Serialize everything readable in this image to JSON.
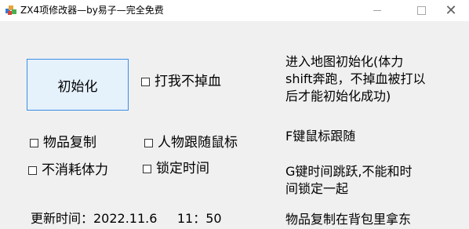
{
  "window": {
    "title": "ZX4项修改器—by易子—完全免费",
    "minimize_glyph": "—",
    "maximize_glyph": "□",
    "close_glyph": "✕",
    "app_icon": "colorful-cubes-icon"
  },
  "controls": {
    "init_button": "初始化",
    "checkbox_no_blood": "打我不掉血",
    "checkbox_item_duplicate": "物品复制",
    "checkbox_follow_mouse": "人物跟随鼠标",
    "checkbox_infinite_stamina": "不消耗体力",
    "checkbox_lock_time": "锁定时间"
  },
  "instructions": {
    "line1": "进入地图初始化(体力",
    "line2": "shift奔跑，不掉血被打以",
    "line3": "后才能初始化成功)",
    "line4": "F键鼠标跟随",
    "line5": "G键时间跳跃,不能和时",
    "line6": "间锁定一起",
    "line7": "物品复制在背包里拿东"
  },
  "footer": {
    "update_time": "更新时间：2022.11.6     11：50"
  }
}
